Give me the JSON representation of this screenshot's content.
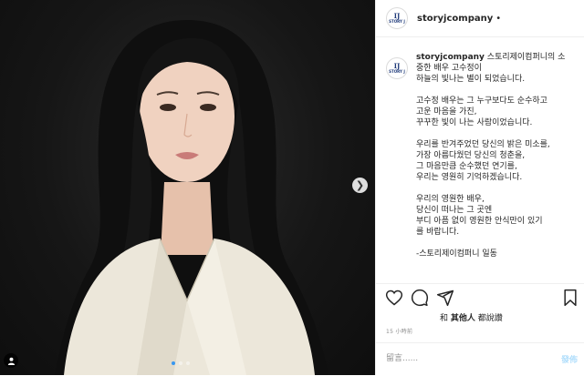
{
  "photo": {
    "subject": "portrait",
    "next_icon": "chevron-right-icon",
    "carousel_count": 3,
    "carousel_active_index": 0,
    "user_tag_icon": "person-icon"
  },
  "header": {
    "username": "storyjcompany",
    "separator": "•",
    "logo_mark": "IJ",
    "logo_word": "STORY J"
  },
  "caption": {
    "username": "storyjcompany",
    "first_line": " 스토리제이컴퍼니의 소",
    "line2": "중한 배우 고수정이",
    "line3": "하늘의 빛나는 별이 되었습니다.",
    "p2": [
      "고수정 배우는 그 누구보다도 순수하고",
      "고운 마음을 가진,",
      "꾸꾸한 빛이 나는 사람이었습니다."
    ],
    "p3": [
      "우리를 반겨주었던 당신의 밝은 미소를,",
      "가장 아름다웠던 당신의 청춘을,",
      "그 마음만큼 순수했던 연기를,",
      "우리는 영원히 기억하겠습니다."
    ],
    "p4": [
      "우리의 영원한 배우,",
      "당신이 떠나는 그 곳엔",
      "부디 아픔 없이 영원한 안식만이 있기",
      "를 바랍니다."
    ],
    "p5": [
      "-스토리제이컴퍼니 일동"
    ]
  },
  "actions": {
    "like_icon": "heart-icon",
    "comment_icon": "comment-icon",
    "share_icon": "send-icon",
    "save_icon": "bookmark-icon"
  },
  "likes": {
    "prefix": "和 ",
    "bold": "其他人",
    "suffix": " 都說讚"
  },
  "timestamp": "15 小時前",
  "comment": {
    "placeholder": "留言......",
    "post_label": "發佈"
  },
  "colors": {
    "accent": "#3897f0",
    "post_disabled": "#b2dffc",
    "text": "#262626",
    "muted": "#8e8e8e"
  }
}
